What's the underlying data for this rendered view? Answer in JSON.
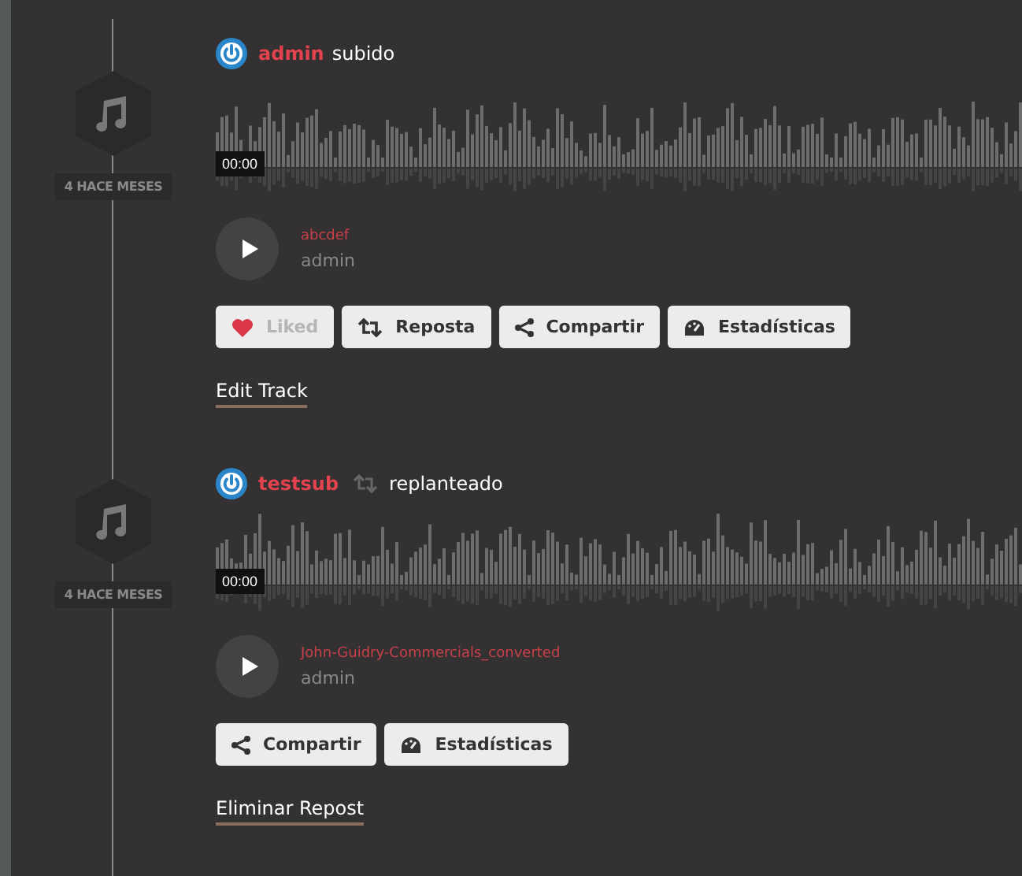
{
  "posts": [
    {
      "kind": "upload",
      "user": "admin",
      "action": "subido",
      "date": "4 HACE MESES",
      "time": "00:00",
      "track": {
        "title": "abcdef",
        "artist": "admin"
      },
      "buttons": [
        {
          "kind": "like",
          "label": "Liked",
          "liked": true
        },
        {
          "kind": "repost",
          "label": "Reposta"
        },
        {
          "kind": "share",
          "label": "Compartir"
        },
        {
          "kind": "stats",
          "label": "Estadísticas"
        }
      ],
      "link": "Edit Track"
    },
    {
      "kind": "repost",
      "user": "testsub",
      "action": "replanteado",
      "date": "4 HACE MESES",
      "time": "00:00",
      "track": {
        "title": "John-Guidry-Commercials_converted",
        "artist": "admin"
      },
      "buttons": [
        {
          "kind": "share",
          "label": "Compartir"
        },
        {
          "kind": "stats",
          "label": "Estadísticas"
        }
      ],
      "link": "Eliminar Repost"
    }
  ]
}
